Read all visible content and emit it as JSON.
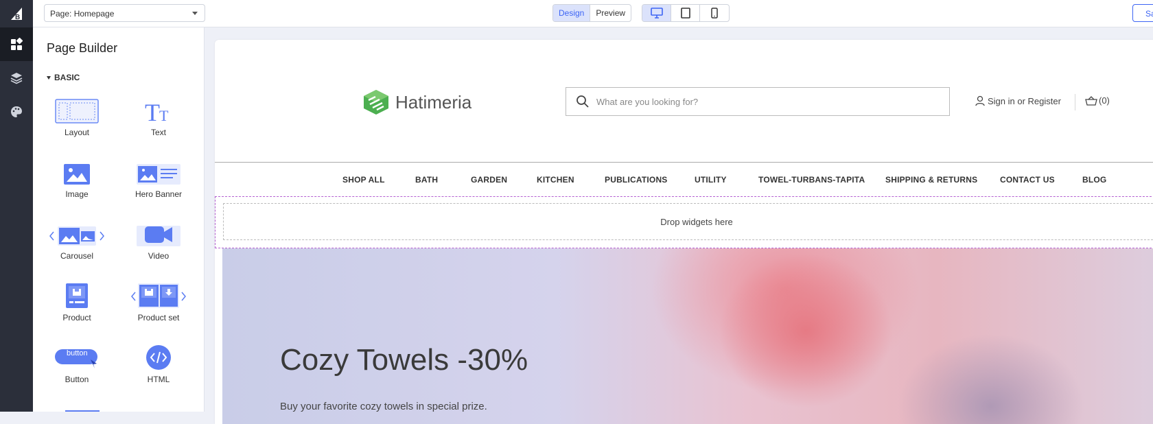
{
  "topbar": {
    "page_select": "Page: Homepage",
    "mode_design": "Design",
    "mode_preview": "Preview",
    "save_label": "Sa"
  },
  "sidebar": {
    "title": "Page Builder",
    "section": "BASIC",
    "widgets": [
      {
        "label": "Layout"
      },
      {
        "label": "Text"
      },
      {
        "label": "Image"
      },
      {
        "label": "Hero Banner"
      },
      {
        "label": "Carousel"
      },
      {
        "label": "Video"
      },
      {
        "label": "Product"
      },
      {
        "label": "Product set"
      },
      {
        "label": "Button",
        "icon_text": "button"
      },
      {
        "label": "HTML"
      }
    ]
  },
  "store": {
    "brand": "Hatimeria",
    "search_placeholder": "What are you looking for?",
    "account": "Sign in or Register",
    "cart": "(0)",
    "menu": [
      "SHOP ALL",
      "BATH",
      "GARDEN",
      "KITCHEN",
      "PUBLICATIONS",
      "UTILITY",
      "TOWEL-TURBANS-TAPITA",
      "SHIPPING & RETURNS",
      "CONTACT US",
      "BLOG"
    ]
  },
  "dropzone": "Drop widgets here",
  "hero": {
    "title": "Cozy Towels -30%",
    "subtitle": "Buy your favorite cozy towels in special prize."
  },
  "colors": {
    "accent": "#3c64f4",
    "rail": "#2b2f3a",
    "drop_outline": "#b45fd1",
    "logo_green": "#4caf50"
  }
}
